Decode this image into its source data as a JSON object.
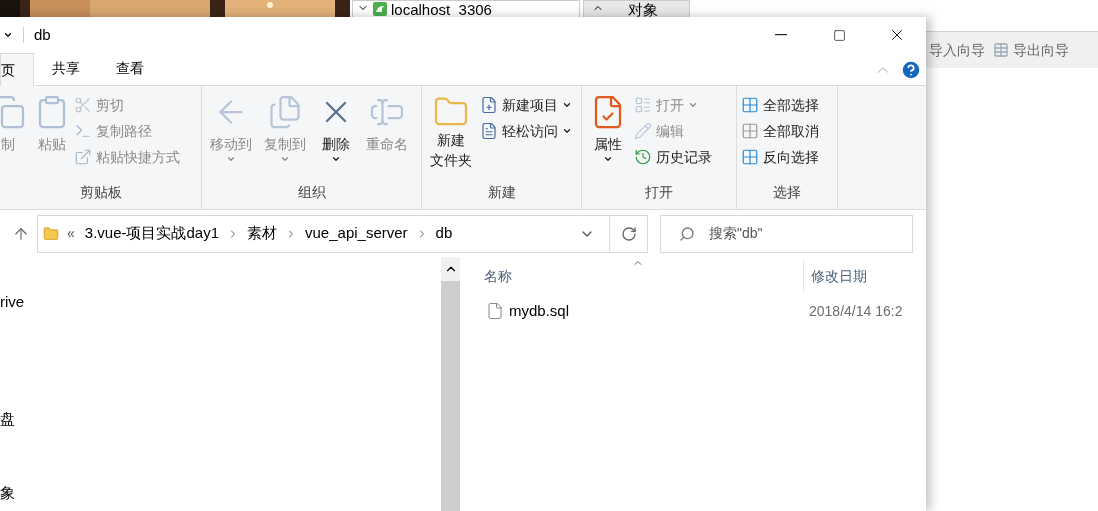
{
  "background_app": {
    "connection_tab": "localhost_3306",
    "object_tab": "对象",
    "toolbar": [
      "导入向导",
      "导出向导"
    ]
  },
  "window": {
    "title": "db",
    "ribbon_tabs": [
      {
        "label": "页",
        "selected": true
      },
      {
        "label": "共享",
        "selected": false
      },
      {
        "label": "查看",
        "selected": false
      }
    ],
    "ribbon_groups": [
      {
        "label": "剪贴板",
        "items": [
          {
            "kind": "large",
            "label": "制",
            "disabled": true,
            "dropdown": false
          },
          {
            "kind": "large",
            "label": "粘贴",
            "disabled": true,
            "dropdown": false
          },
          {
            "kind": "small",
            "label": "剪切",
            "disabled": true,
            "dropdown": false
          },
          {
            "kind": "small",
            "label": "复制路径",
            "disabled": true,
            "dropdown": false
          },
          {
            "kind": "small",
            "label": "粘贴快捷方式",
            "disabled": true,
            "dropdown": false
          }
        ]
      },
      {
        "label": "组织",
        "items": [
          {
            "kind": "large",
            "label": "移动到",
            "disabled": true,
            "dropdown": true
          },
          {
            "kind": "large",
            "label": "复制到",
            "disabled": true,
            "dropdown": true
          },
          {
            "kind": "large",
            "label": "删除",
            "disabled": false,
            "dropdown": true
          },
          {
            "kind": "large",
            "label": "重命名",
            "disabled": true,
            "dropdown": false
          }
        ]
      },
      {
        "label": "新建",
        "items": [
          {
            "kind": "large",
            "label": [
              "新建",
              "文件夹"
            ],
            "disabled": false,
            "dropdown": false
          },
          {
            "kind": "small",
            "label": "新建项目",
            "disabled": false,
            "dropdown": true
          },
          {
            "kind": "small",
            "label": "轻松访问",
            "disabled": false,
            "dropdown": true
          }
        ]
      },
      {
        "label": "打开",
        "items": [
          {
            "kind": "large",
            "label": "属性",
            "disabled": false,
            "dropdown": true
          },
          {
            "kind": "small",
            "label": "打开",
            "disabled": true,
            "dropdown": true
          },
          {
            "kind": "small",
            "label": "编辑",
            "disabled": true,
            "dropdown": false
          },
          {
            "kind": "small",
            "label": "历史记录",
            "disabled": false,
            "dropdown": false
          }
        ]
      },
      {
        "label": "选择",
        "items": [
          {
            "kind": "small",
            "label": "全部选择",
            "disabled": false,
            "dropdown": false
          },
          {
            "kind": "small",
            "label": "全部取消",
            "disabled": false,
            "dropdown": false
          },
          {
            "kind": "small",
            "label": "反向选择",
            "disabled": false,
            "dropdown": false
          }
        ]
      }
    ],
    "address": {
      "overflow": "«",
      "crumbs": [
        "3.vue-项目实战day1",
        "素材",
        "vue_api_server",
        "db"
      ]
    },
    "search": {
      "placeholder": "搜索\"db\""
    },
    "nav_pane": [
      "rive",
      "盘",
      "象"
    ],
    "columns": [
      "名称",
      "修改日期"
    ],
    "files": [
      {
        "name": "mydb.sql",
        "modified": "2018/4/14 16:2"
      }
    ]
  }
}
